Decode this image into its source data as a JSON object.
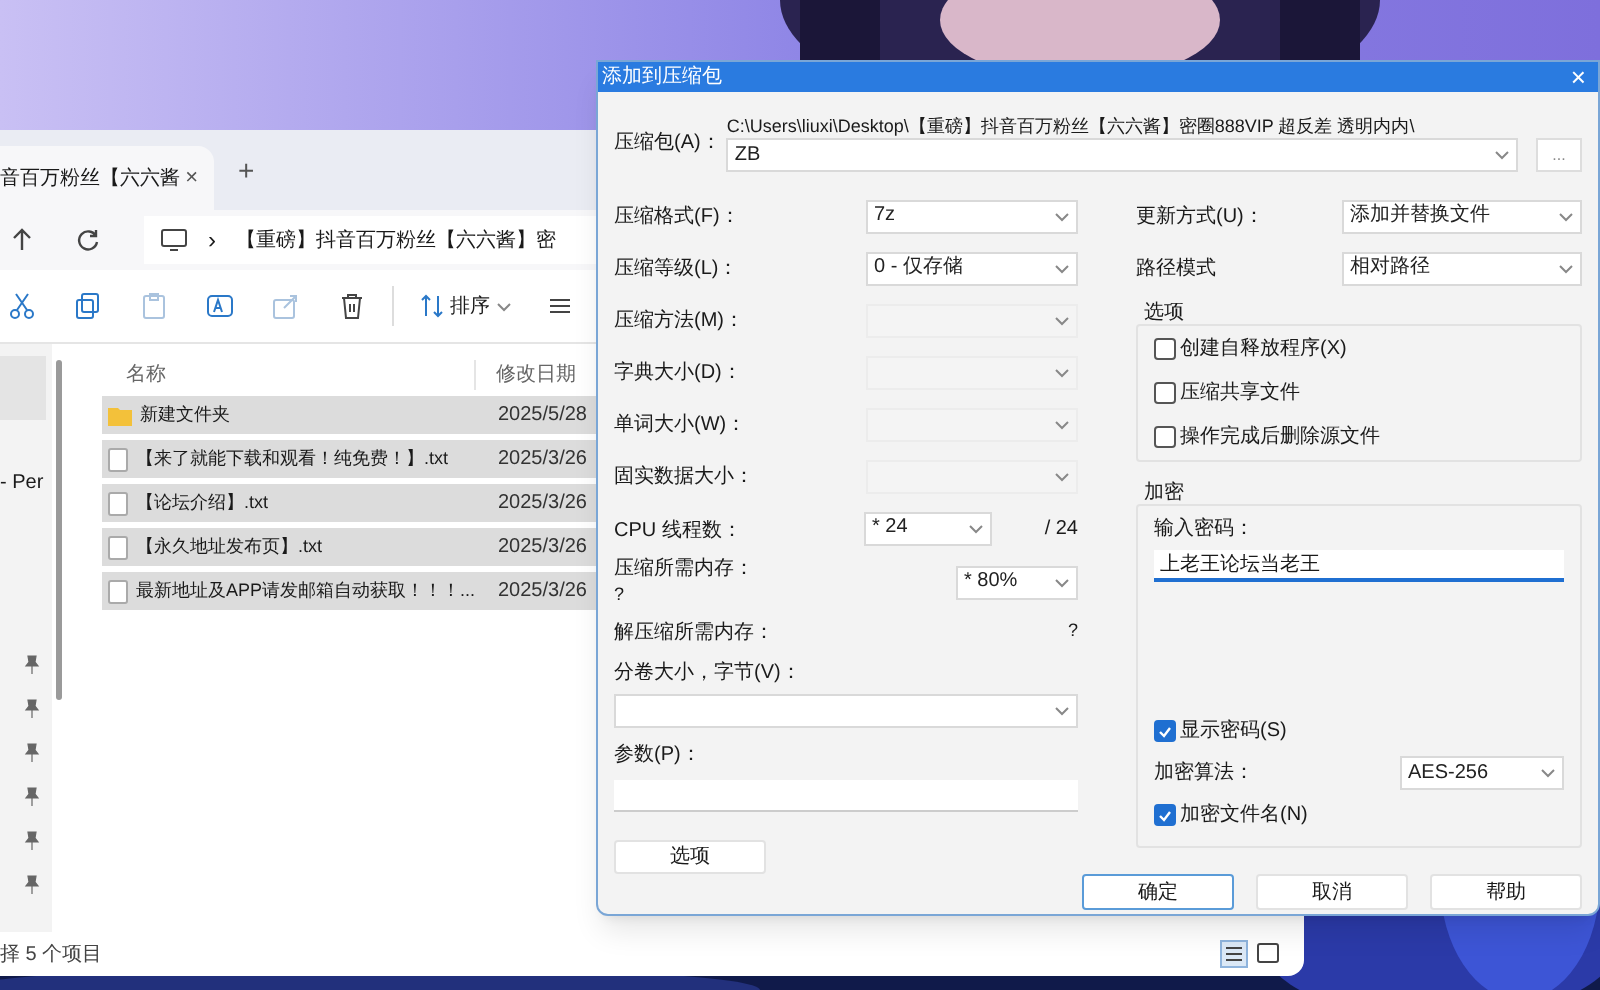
{
  "explorer": {
    "tab_title": "音百万粉丝【六六酱",
    "tab_close": "×",
    "new_tab": "+",
    "breadcrumb_separator": "›",
    "breadcrumb": "【重磅】抖音百万粉丝【六六酱】密",
    "sort_label": "排序",
    "nav_item": "- Per",
    "columns": [
      "名称",
      "修改日期"
    ],
    "files": [
      {
        "kind": "folder",
        "name": "新建文件夹",
        "date": "2025/5/28",
        "selected": true
      },
      {
        "kind": "file",
        "name": "【来了就能下载和观看！纯免费！】.txt",
        "date": "2025/3/26",
        "selected": true
      },
      {
        "kind": "file",
        "name": "【论坛介绍】.txt",
        "date": "2025/3/26",
        "selected": true
      },
      {
        "kind": "file",
        "name": "【永久地址发布页】.txt",
        "date": "2025/3/26",
        "selected": true
      },
      {
        "kind": "file",
        "name": "最新地址及APP请发邮箱自动获取！！！...",
        "date": "2025/3/26",
        "selected": true
      }
    ],
    "status": "择 5 个项目"
  },
  "dialog": {
    "title": "添加到压缩包",
    "close": "×",
    "archive": {
      "label": "压缩包(A)：",
      "path": "C:\\Users\\liuxi\\Desktop\\【重磅】抖音百万粉丝【六六酱】密圈888VIP 超反差 透明内内\\",
      "value": "ZB",
      "browse": "..."
    },
    "left_fields": [
      {
        "kind": "select",
        "label": "压缩格式(F)：",
        "value": "7z",
        "disabled": false
      },
      {
        "kind": "select",
        "label": "压缩等级(L)：",
        "value": "0 - 仅存储",
        "disabled": false
      },
      {
        "kind": "select",
        "label": "压缩方法(M)：",
        "disabled": true
      },
      {
        "kind": "select",
        "label": "字典大小(D)：",
        "disabled": true
      },
      {
        "kind": "select",
        "label": "单词大小(W)：",
        "disabled": true
      },
      {
        "kind": "select",
        "label": "固实数据大小：",
        "disabled": true
      },
      {
        "kind": "threads",
        "label": "CPU 线程数：",
        "value": "* 24",
        "suffix": "/ 24"
      },
      {
        "kind": "memory",
        "label": "压缩所需内存：",
        "note": "?",
        "value": "* 80%"
      },
      {
        "kind": "info",
        "label": "解压缩所需内存：",
        "note": "?"
      },
      {
        "kind": "wide-select",
        "label": "分卷大小，字节(V)："
      },
      {
        "kind": "text-field",
        "label": "参数(P)："
      }
    ],
    "options_button": "选项",
    "right_fields": [
      {
        "label": "更新方式(U)：",
        "value": "添加并替换文件"
      },
      {
        "label": "路径模式",
        "value": "相对路径"
      }
    ],
    "options_group": {
      "title": "选项",
      "checkboxes": [
        {
          "label": "创建自释放程序(X)",
          "checked": false
        },
        {
          "label": "压缩共享文件",
          "checked": false
        },
        {
          "label": "操作完成后删除源文件",
          "checked": false
        }
      ]
    },
    "encryption": {
      "title": "加密",
      "password_label": "输入密码：",
      "password": "上老王论坛当老王",
      "show_password": {
        "label": "显示密码(S)",
        "checked": true
      },
      "algorithm_label": "加密算法：",
      "algorithm": "AES-256",
      "encrypt_names": {
        "label": "加密文件名(N)",
        "checked": true
      }
    },
    "buttons": [
      {
        "label": "确定",
        "default": true
      },
      {
        "label": "取消",
        "default": false
      },
      {
        "label": "帮助",
        "default": false
      }
    ]
  }
}
